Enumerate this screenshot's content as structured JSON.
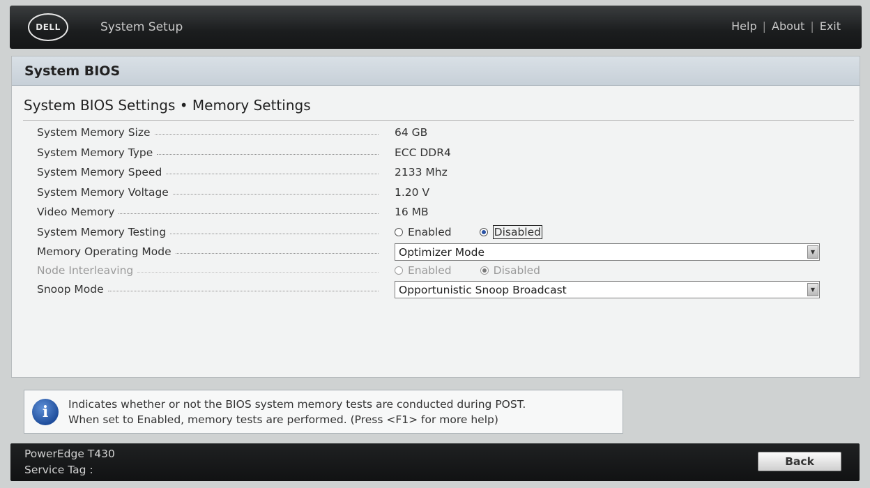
{
  "header": {
    "logo": "DELL",
    "title": "System Setup",
    "links": [
      "Help",
      "About",
      "Exit"
    ],
    "separator": "|"
  },
  "panel": {
    "title": "System BIOS",
    "subtitle": "System BIOS Settings • Memory Settings"
  },
  "settings": [
    {
      "label": "System Memory Size",
      "value": "64 GB"
    },
    {
      "label": "System Memory Type",
      "value": "ECC DDR4"
    },
    {
      "label": "System Memory Speed",
      "value": "2133 Mhz"
    },
    {
      "label": "System Memory Voltage",
      "value": "1.20 V"
    },
    {
      "label": "Video Memory",
      "value": "16 MB"
    },
    {
      "label": "System Memory Testing",
      "options": [
        "Enabled",
        "Disabled"
      ],
      "selected": "Disabled"
    },
    {
      "label": "Memory Operating Mode",
      "value": "Optimizer Mode"
    },
    {
      "label": "Node Interleaving",
      "options": [
        "Enabled",
        "Disabled"
      ],
      "selected": "Disabled",
      "disabled": true
    },
    {
      "label": "Snoop Mode",
      "value": "Opportunistic Snoop Broadcast"
    }
  ],
  "help": {
    "icon": "info-icon",
    "icon_glyph": "i",
    "line1": "Indicates whether or not the BIOS system memory tests are conducted during POST.",
    "line2": "When set to Enabled, memory tests are performed. (Press <F1> for more help)"
  },
  "footer": {
    "model": "PowerEdge T430",
    "service_tag": "Service Tag :",
    "back_label": "Back"
  }
}
